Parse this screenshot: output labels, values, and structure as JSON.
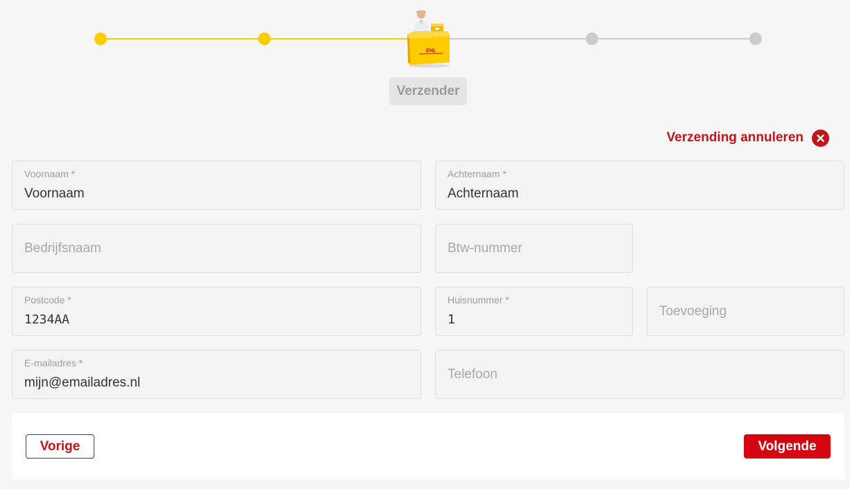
{
  "progress": {
    "current_step_label": "Verzender",
    "steps_completed": 2,
    "steps_total": 5,
    "active_color": "#ffcc00",
    "inactive_color": "#cccccc"
  },
  "cancel": {
    "label": "Verzending annuleren",
    "icon": "close-circle-icon"
  },
  "form": {
    "first_name": {
      "label": "Voornaam *",
      "value": "Voornaam"
    },
    "last_name": {
      "label": "Achternaam *",
      "value": "Achternaam"
    },
    "company": {
      "placeholder": "Bedrijfsnaam"
    },
    "vat": {
      "placeholder": "Btw-nummer"
    },
    "postcode": {
      "label": "Postcode *",
      "value": "1234AA"
    },
    "house_number": {
      "label": "Huisnummer *",
      "value": "1"
    },
    "addition": {
      "placeholder": "Toevoeging"
    },
    "email": {
      "label": "E-mailadres *",
      "value": "mijn@emailadres.nl"
    },
    "phone": {
      "placeholder": "Telefoon"
    }
  },
  "footer": {
    "prev_label": "Vorige",
    "next_label": "Volgende"
  },
  "colors": {
    "brand_red": "#d40511",
    "brand_yellow": "#ffcc00"
  }
}
